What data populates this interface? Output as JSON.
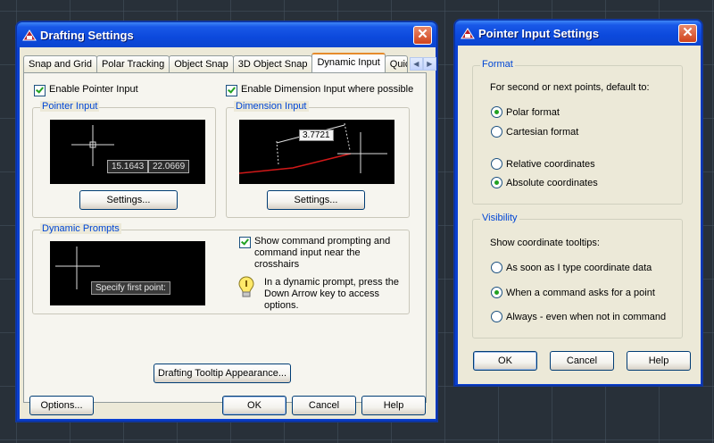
{
  "drafting": {
    "title": "Drafting Settings",
    "tabs": [
      "Snap and Grid",
      "Polar Tracking",
      "Object Snap",
      "3D Object Snap",
      "Dynamic Input",
      "Quic"
    ],
    "enable_pointer_input": "Enable Pointer Input",
    "enable_dimension_input": "Enable Dimension Input where possible",
    "pointer_input_group": "Pointer Input",
    "pointer_coord_x": "15.1643",
    "pointer_coord_y": "22.0669",
    "pointer_settings": "Settings...",
    "dimension_input_group": "Dimension Input",
    "dimension_value": "3.7721",
    "dimension_settings": "Settings...",
    "dynamic_prompts_group": "Dynamic Prompts",
    "prompt_text": "Specify first point:",
    "show_command_prompting": "Show command prompting and command input near the crosshairs",
    "info_text": "In a dynamic prompt, press the Down Arrow key to access options.",
    "tooltip_appearance": "Drafting Tooltip Appearance...",
    "options": "Options...",
    "ok": "OK",
    "cancel": "Cancel",
    "help": "Help"
  },
  "pointer": {
    "title": "Pointer Input Settings",
    "format_group": "Format",
    "format_intro": "For second or next points, default to:",
    "polar_format": "Polar format",
    "cartesian_format": "Cartesian format",
    "relative_coords": "Relative coordinates",
    "absolute_coords": "Absolute coordinates",
    "visibility_group": "Visibility",
    "visibility_intro": "Show coordinate tooltips:",
    "as_soon_as": "As soon as I type coordinate data",
    "when_command": "When a command asks for a point",
    "always": "Always - even when not in command",
    "ok": "OK",
    "cancel": "Cancel",
    "help": "Help"
  },
  "colors": {
    "title_bar": "#0c49dc",
    "dialog_bg": "#ece9d8",
    "group_label": "#0046d5",
    "check_mark": "#21a121",
    "active_tab_accent": "#e68b2c",
    "close_button": "#d0431c"
  }
}
